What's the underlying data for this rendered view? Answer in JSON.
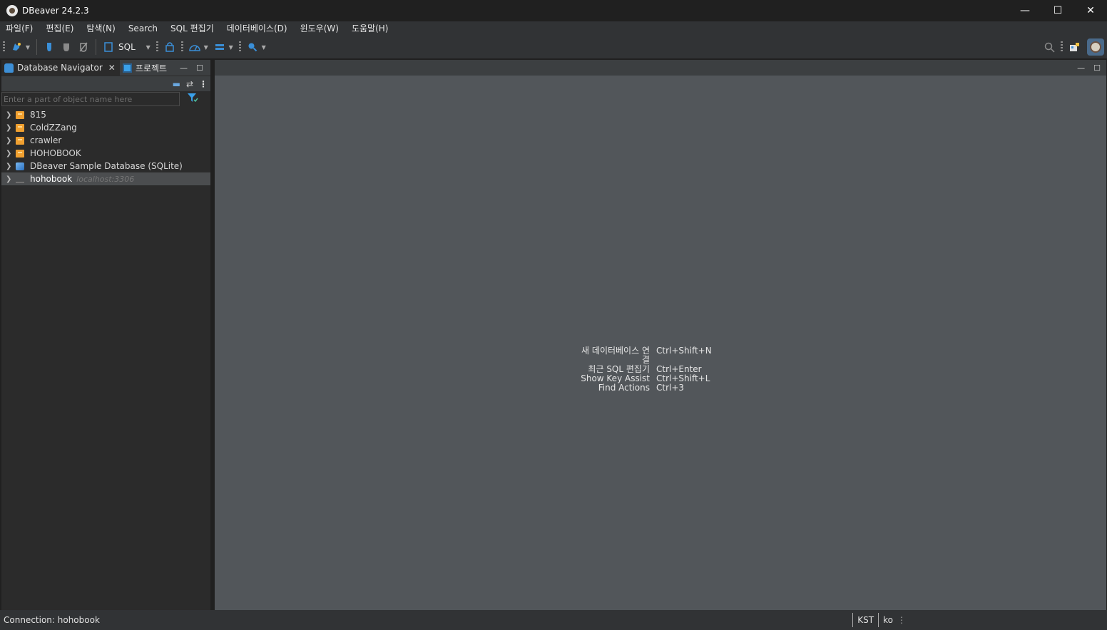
{
  "window": {
    "title": "DBeaver 24.2.3",
    "controls": {
      "minimize": "—",
      "maximize": "☐",
      "close": "✕"
    }
  },
  "menu": [
    {
      "label": "파일(F)"
    },
    {
      "label": "편집(E)"
    },
    {
      "label": "탐색(N)"
    },
    {
      "label": "Search"
    },
    {
      "label": "SQL 편집기"
    },
    {
      "label": "데이터베이스(D)"
    },
    {
      "label": "윈도우(W)"
    },
    {
      "label": "도움말(H)"
    }
  ],
  "toolbar": {
    "sql_label": "SQL",
    "icons": [
      "new-connection-icon",
      "connect-icon",
      "disconnect-icon",
      "invalidate-icon",
      "sql-editor-icon",
      "transaction-icon",
      "performance-icon",
      "commit-icon",
      "search-icon"
    ],
    "right_icons": [
      "global-search-icon",
      "perspective-icon",
      "user-avatar-icon"
    ]
  },
  "navigator": {
    "tabs": [
      {
        "label": "Database Navigator",
        "active": true
      },
      {
        "label": "프로젝트",
        "active": false
      }
    ],
    "filter_placeholder": "Enter a part of object name here",
    "filter_value": "",
    "items": [
      {
        "label": "815",
        "hint": "",
        "icon": "folder-icon",
        "selected": false
      },
      {
        "label": "ColdZZang",
        "hint": "",
        "icon": "folder-icon",
        "selected": false
      },
      {
        "label": "crawler",
        "hint": "",
        "icon": "folder-icon",
        "selected": false
      },
      {
        "label": "HOHOBOOK",
        "hint": "",
        "icon": "folder-icon",
        "selected": false
      },
      {
        "label": "DBeaver Sample Database (SQLite)",
        "hint": "",
        "icon": "sqlite-icon",
        "selected": false
      },
      {
        "label": "hohobook",
        "hint": "localhost:3306",
        "icon": "mysql-icon",
        "selected": true
      }
    ]
  },
  "editor": {
    "shortcuts": [
      {
        "label": "새 데이터베이스 연결",
        "keys": "Ctrl+Shift+N"
      },
      {
        "label": "최근 SQL 편집기",
        "keys": "Ctrl+Enter"
      },
      {
        "label": "Show Key Assist",
        "keys": "Ctrl+Shift+L"
      },
      {
        "label": "Find Actions",
        "keys": "Ctrl+3"
      }
    ]
  },
  "status": {
    "connection": "Connection: hohobook",
    "timezone": "KST",
    "locale": "ko"
  }
}
